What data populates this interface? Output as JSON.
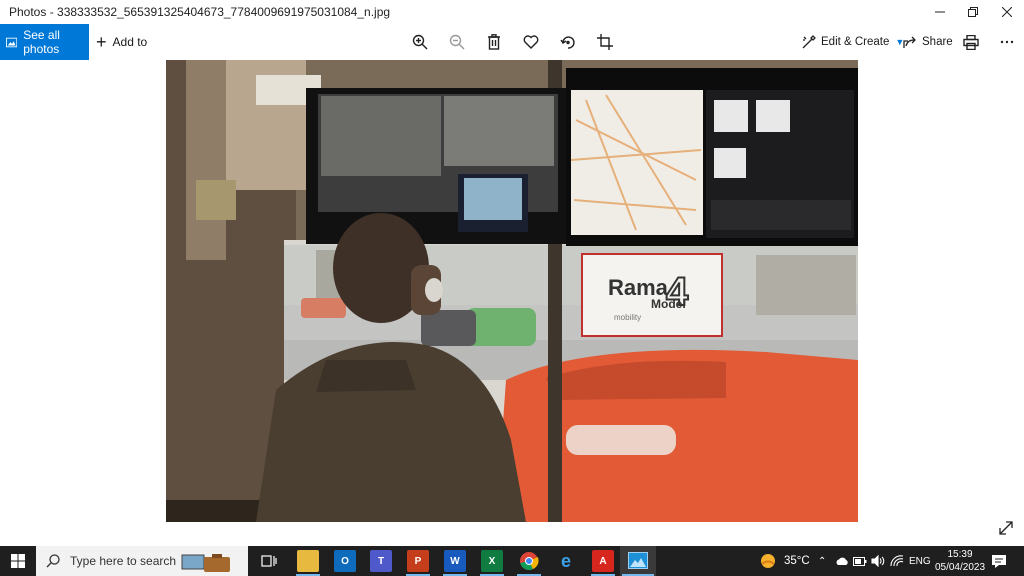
{
  "window": {
    "title": "Photos - 338333532_565391325404673_7784009691975031084_n.jpg"
  },
  "toolbar": {
    "see_all_label": "See all photos",
    "add_to_label": "Add to",
    "edit_create_label": "Edit & Create",
    "share_label": "Share"
  },
  "photo": {
    "sign_title": "Rama",
    "sign_number": "4",
    "sign_subtitle": "Model",
    "sign_footer": "mobility"
  },
  "taskbar": {
    "search_placeholder": "Type here to search",
    "weather": "35°C",
    "language": "ENG",
    "time": "15:39",
    "date": "05/04/2023"
  },
  "colors": {
    "accent": "#0078d7",
    "taskbar": "#1f1f1f"
  }
}
